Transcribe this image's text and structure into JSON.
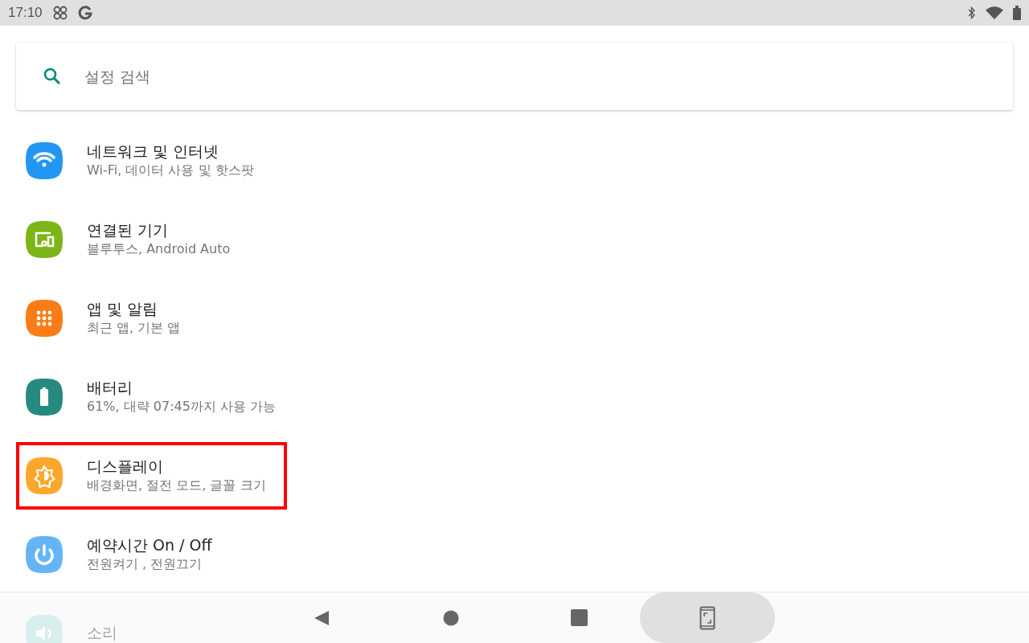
{
  "status_bar": {
    "time": "17:10"
  },
  "search": {
    "placeholder": "설정 검색"
  },
  "settings": [
    {
      "kind": "wifi",
      "color": "#2196f3",
      "title": "네트워크 및 인터넷",
      "subtitle": "Wi-Fi, 데이터 사용 및 핫스팟",
      "highlighted": false
    },
    {
      "kind": "devices",
      "color": "#7cb518",
      "title": "연결된 기기",
      "subtitle": "블루투스, Android Auto",
      "highlighted": false
    },
    {
      "kind": "apps",
      "color": "#fb7c16",
      "title": "앱 및 알림",
      "subtitle": "최근 앱, 기본 앱",
      "highlighted": false
    },
    {
      "kind": "battery",
      "color": "#268a7f",
      "title": "배터리",
      "subtitle": "61%, 대략 07:45까지 사용 가능",
      "highlighted": false
    },
    {
      "kind": "display",
      "color": "#fba72a",
      "title": "디스플레이",
      "subtitle": "배경화면, 절전 모드, 글꼴 크기",
      "highlighted": true
    },
    {
      "kind": "power",
      "color": "#64b5f6",
      "title": "예약시간 On / Off",
      "subtitle": "전원켜기 , 전원끄기",
      "highlighted": false
    },
    {
      "kind": "sound",
      "color": "#d9efed",
      "title": "소리",
      "highlighted": false,
      "dimmed": true
    }
  ]
}
